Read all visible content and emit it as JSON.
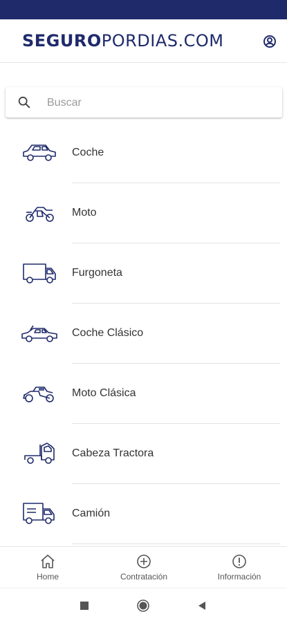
{
  "app": {
    "logo_part1": "SEGURO",
    "logo_part2": "PORDIAS.COM",
    "brand_color": "#1f2a6b"
  },
  "search": {
    "placeholder": "Buscar",
    "value": ""
  },
  "vehicles": [
    {
      "label": "Coche",
      "icon": "car-icon"
    },
    {
      "label": "Moto",
      "icon": "motorcycle-icon"
    },
    {
      "label": "Furgoneta",
      "icon": "van-icon"
    },
    {
      "label": "Coche Clásico",
      "icon": "classic-car-icon"
    },
    {
      "label": "Moto Clásica",
      "icon": "classic-motorcycle-icon"
    },
    {
      "label": "Cabeza Tractora",
      "icon": "tractor-unit-icon"
    },
    {
      "label": "Camión",
      "icon": "truck-icon"
    }
  ],
  "bottom_nav": [
    {
      "label": "Home",
      "icon": "home-icon"
    },
    {
      "label": "Contratación",
      "icon": "add-circle-icon"
    },
    {
      "label": "Información",
      "icon": "info-icon"
    }
  ],
  "system_nav": [
    "recents-icon",
    "home-circle-icon",
    "back-icon"
  ]
}
